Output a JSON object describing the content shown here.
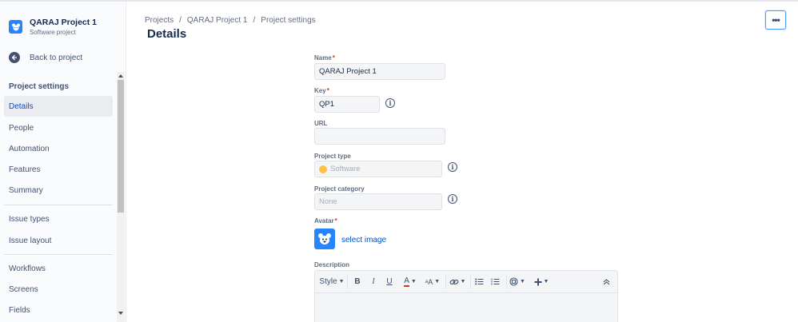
{
  "project": {
    "name": "QARAJ Project 1",
    "type": "Software project"
  },
  "sidebar": {
    "back_label": "Back to project",
    "section_title": "Project settings",
    "items": [
      {
        "label": "Details",
        "active": true
      },
      {
        "label": "People"
      },
      {
        "label": "Automation"
      },
      {
        "label": "Features"
      },
      {
        "label": "Summary"
      },
      {
        "label": "Issue types"
      },
      {
        "label": "Issue layout"
      },
      {
        "label": "Workflows"
      },
      {
        "label": "Screens"
      },
      {
        "label": "Fields"
      }
    ]
  },
  "breadcrumb": [
    "Projects",
    "QARAJ Project 1",
    "Project settings"
  ],
  "breadcrumb_sep": "/",
  "page_title": "Details",
  "more_button_label": "•••",
  "form": {
    "name": {
      "label": "Name",
      "required": "*",
      "value": "QARAJ Project 1"
    },
    "key": {
      "label": "Key",
      "required": "*",
      "value": "QP1"
    },
    "url": {
      "label": "URL",
      "value": ""
    },
    "project_type": {
      "label": "Project type",
      "value": "Software"
    },
    "project_category": {
      "label": "Project category",
      "placeholder": "None"
    },
    "avatar": {
      "label": "Avatar",
      "required": "*",
      "link": "select image"
    },
    "description": {
      "label": "Description"
    }
  },
  "editor_toolbar": {
    "style_label": "Style",
    "bold": "B",
    "italic": "I",
    "underline": "U",
    "text_color": "A",
    "more_format": "ᵃA"
  },
  "colors": {
    "accent": "#0052cc",
    "required": "#de350b",
    "avatar_bg": "#2684ff"
  }
}
